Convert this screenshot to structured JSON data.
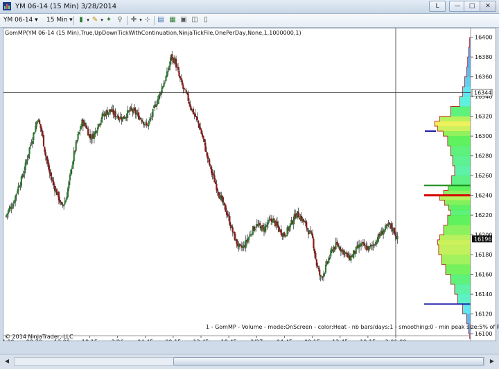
{
  "window": {
    "title": "YM 06-14 (15 Min)  3/28/2014",
    "buttons": [
      "L",
      "□",
      "✕"
    ]
  },
  "toolbar": {
    "instrument": "YM 06-14",
    "interval": "15 Min",
    "icons": [
      "candlestick-icon",
      "pencil-icon",
      "pin-icon",
      "link-icon",
      "crosshair-icon",
      "indicator-icon",
      "strategy-icon",
      "image-icon",
      "properties-icon"
    ]
  },
  "indicator_label": "GomMP(YM 06-14 (15 Min),True,UpDownTickWithContinuation,NinjaTickFile,OnePerDay,None,1,1000000,1)",
  "status_text": "1 - GomMP - Volume - mode:OnScreen - color:Heat - nb bars/days:1 - smoothing:0 - min peak size:5% of POC",
  "copyright": "© 2014 NinjaTrader, LLC",
  "colors": {
    "up_candle": "#2e7d32",
    "down_candle": "#8b1a1a",
    "poc_line": "#d50000",
    "value_area_line": "#1a8c1a",
    "profile_low": "#1a1aa8",
    "crosshair": "#333333"
  },
  "chart_data": {
    "type": "candlestick",
    "y_axis": {
      "ticks": [
        "16400",
        "16380",
        "16360",
        "16340",
        "16320",
        "16300",
        "16280",
        "16260",
        "16240",
        "16220",
        "16200",
        "16180",
        "16160",
        "16140",
        "16120",
        "16100"
      ],
      "range": [
        16098,
        16404
      ],
      "crosshair_price": "16344",
      "last_price": "16196"
    },
    "x_axis": {
      "ticks": [
        "14:00",
        "08:30",
        "13:00",
        "18:15",
        "3/26",
        "04:45",
        "09:15",
        "13:45",
        "18:45",
        "3/27",
        "04:45",
        "09:15",
        "13:45",
        "19:15",
        "3:01:00"
      ]
    },
    "price_path": [
      16218,
      16226,
      16232,
      16246,
      16256,
      16270,
      16288,
      16302,
      16318,
      16305,
      16280,
      16262,
      16250,
      16240,
      16228,
      16236,
      16258,
      16282,
      16300,
      16314,
      16310,
      16298,
      16302,
      16312,
      16320,
      16324,
      16326,
      16322,
      16320,
      16318,
      16322,
      16326,
      16324,
      16320,
      16316,
      16310,
      16318,
      16330,
      16340,
      16352,
      16362,
      16380,
      16376,
      16360,
      16348,
      16340,
      16328,
      16320,
      16310,
      16296,
      16278,
      16264,
      16252,
      16240,
      16230,
      16220,
      16206,
      16194,
      16186,
      16188,
      16196,
      16204,
      16210,
      16208,
      16206,
      16212,
      16216,
      16210,
      16204,
      16200,
      16206,
      16214,
      16222,
      16218,
      16212,
      16204,
      16196,
      16170,
      16156,
      16164,
      16176,
      16186,
      16190,
      16186,
      16182,
      16176,
      16180,
      16186,
      16190,
      16188,
      16186,
      16190,
      16196,
      16202,
      16206,
      16210,
      16205,
      16196
    ],
    "volume_profile": {
      "poc_price": 16240,
      "value_area_price": 16250,
      "low_marker_price": 16130,
      "high_marker_price": 16305,
      "levels": [
        [
          16400,
          0.02
        ],
        [
          16390,
          0.04
        ],
        [
          16380,
          0.06
        ],
        [
          16370,
          0.08
        ],
        [
          16360,
          0.12
        ],
        [
          16350,
          0.16
        ],
        [
          16340,
          0.22
        ],
        [
          16330,
          0.4
        ],
        [
          16320,
          0.62
        ],
        [
          16315,
          0.72
        ],
        [
          16310,
          0.66
        ],
        [
          16305,
          0.55
        ],
        [
          16300,
          0.46
        ],
        [
          16290,
          0.4
        ],
        [
          16280,
          0.36
        ],
        [
          16270,
          0.32
        ],
        [
          16260,
          0.38
        ],
        [
          16250,
          0.45
        ],
        [
          16245,
          0.54
        ],
        [
          16240,
          0.62
        ],
        [
          16235,
          0.52
        ],
        [
          16230,
          0.44
        ],
        [
          16225,
          0.4
        ],
        [
          16220,
          0.46
        ],
        [
          16210,
          0.54
        ],
        [
          16200,
          0.62
        ],
        [
          16195,
          0.66
        ],
        [
          16190,
          0.64
        ],
        [
          16180,
          0.58
        ],
        [
          16170,
          0.5
        ],
        [
          16160,
          0.4
        ],
        [
          16150,
          0.32
        ],
        [
          16140,
          0.26
        ],
        [
          16130,
          0.16
        ],
        [
          16120,
          0.08
        ],
        [
          16110,
          0.04
        ],
        [
          16100,
          0.02
        ]
      ]
    }
  }
}
